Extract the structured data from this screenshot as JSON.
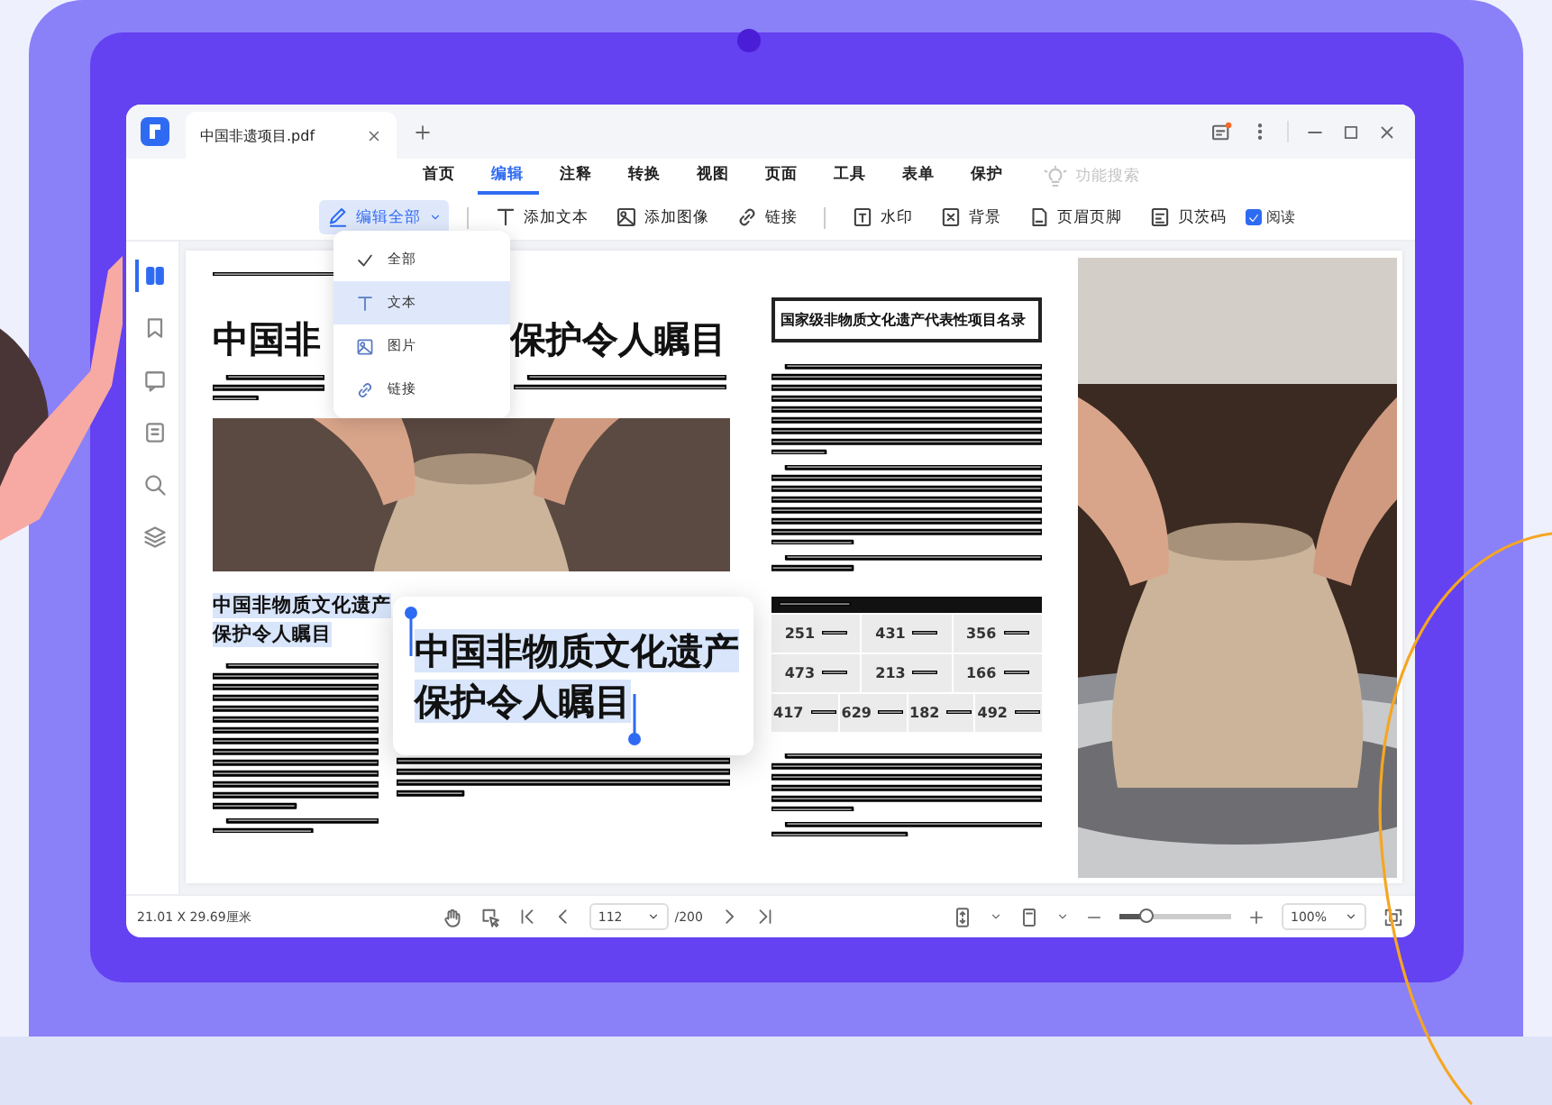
{
  "app": {
    "tab_title": "中国非遗项目.pdf"
  },
  "menu": [
    {
      "label": "首页",
      "selected": false
    },
    {
      "label": "编辑",
      "selected": true
    },
    {
      "label": "注释",
      "selected": false
    },
    {
      "label": "转换",
      "selected": false
    },
    {
      "label": "视图",
      "selected": false
    },
    {
      "label": "页面",
      "selected": false
    },
    {
      "label": "工具",
      "selected": false
    },
    {
      "label": "表单",
      "selected": false
    },
    {
      "label": "保护",
      "selected": false
    }
  ],
  "feature_search": {
    "placeholder": "功能搜索"
  },
  "toolbar": [
    {
      "kind": "dropdown",
      "label": "编辑全部",
      "selected": true
    },
    {
      "kind": "separator"
    },
    {
      "kind": "button",
      "label": "添加文本",
      "selected": false
    },
    {
      "kind": "button",
      "label": "添加图像",
      "selected": false
    },
    {
      "kind": "button",
      "label": "链接",
      "selected": false
    },
    {
      "kind": "separator"
    },
    {
      "kind": "button",
      "label": "水印",
      "selected": false
    },
    {
      "kind": "button",
      "label": "背景",
      "selected": false
    },
    {
      "kind": "button",
      "label": "页眉页脚",
      "selected": false
    },
    {
      "kind": "button",
      "label": "贝茨码",
      "selected": false
    },
    {
      "kind": "checkbox",
      "label": "阅读",
      "checked": true
    }
  ],
  "dropdown_menu": [
    {
      "label": "全部",
      "checked": true,
      "selected": false
    },
    {
      "label": "文本",
      "checked": false,
      "selected": true
    },
    {
      "label": "图片",
      "checked": false,
      "selected": false
    },
    {
      "label": "链接",
      "checked": false,
      "selected": false
    }
  ],
  "sidebar": [
    {
      "selected": true
    },
    {
      "selected": false
    },
    {
      "selected": false
    },
    {
      "selected": false
    },
    {
      "selected": false
    },
    {
      "selected": false
    }
  ],
  "document": {
    "title_start": "中国非",
    "title_end": "保护令人瞩目",
    "section_heading": [
      "中国非物质文化遗产",
      "保护令人瞩目"
    ],
    "list_heading": "国家级非物质文化遗产代表性项目名录",
    "stats": [
      [
        "251",
        "431",
        "356"
      ],
      [
        "473",
        "213",
        "166"
      ],
      [
        "417",
        "629",
        "182",
        "492"
      ]
    ]
  },
  "callout": {
    "lines": [
      "中国非物质文化遗产",
      "保护令人瞩目"
    ]
  },
  "status_bar": {
    "page_size": "21.01 X 29.69厘米",
    "page": "112",
    "total": "/200",
    "zoom": "100%",
    "zoom_slider": {
      "level": 0.25
    }
  }
}
